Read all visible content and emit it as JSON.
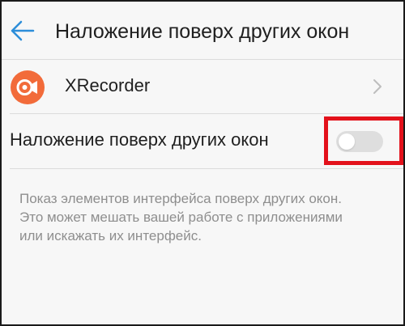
{
  "header": {
    "back_icon": "arrow-left-icon",
    "title": "Наложение поверх других окон"
  },
  "app": {
    "icon": "xrecorder-camera-icon",
    "name": "XRecorder",
    "chevron_icon": "chevron-right-icon"
  },
  "setting": {
    "label": "Наложение поверх других окон",
    "toggle_state": "off"
  },
  "description": {
    "lines": [
      "Показ элементов интерфейса поверх других окон.",
      "Это может мешать вашей работе с приложениями",
      "или искажать их интерфейс."
    ]
  },
  "colors": {
    "accent": "#2d8ed9",
    "highlight": "#e3111b",
    "app_icon": "#f26b3a",
    "toggle_track": "#dedede",
    "background": "#f7f7f7"
  }
}
